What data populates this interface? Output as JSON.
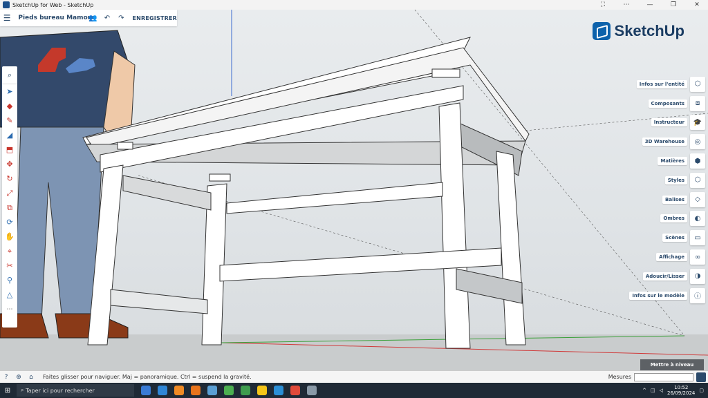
{
  "window": {
    "title": "SketchUp for Web - SketchUp"
  },
  "header": {
    "file_name": "Pieds bureau Mamour",
    "save_label": "ENREGISTRER"
  },
  "logo": {
    "text": "SketchUp"
  },
  "right_panel": [
    {
      "label": "Infos sur l'entité",
      "icon": "info-entity-icon"
    },
    {
      "label": "Composants",
      "icon": "components-icon"
    },
    {
      "label": "Instructeur",
      "icon": "instructor-icon"
    },
    {
      "label": "3D Warehouse",
      "icon": "warehouse-icon"
    },
    {
      "label": "Matières",
      "icon": "materials-icon"
    },
    {
      "label": "Styles",
      "icon": "styles-icon"
    },
    {
      "label": "Balises",
      "icon": "tags-icon"
    },
    {
      "label": "Ombres",
      "icon": "shadows-icon"
    },
    {
      "label": "Scènes",
      "icon": "scenes-icon"
    },
    {
      "label": "Affichage",
      "icon": "display-icon"
    },
    {
      "label": "Adoucir/Lisser",
      "icon": "soften-icon"
    },
    {
      "label": "Infos sur le modèle",
      "icon": "model-info-icon"
    }
  ],
  "level_button": "Mettre à niveau",
  "status": {
    "hint": "Faites glisser pour naviguer. Maj = panoramique. Ctrl = suspend la gravité.",
    "measures_label": "Mesures"
  },
  "taskbar": {
    "search_placeholder": "Taper ici pour rechercher",
    "time": "10:52",
    "date": "26/09/2024"
  },
  "colors": {
    "brand": "#0d62ab",
    "header_text": "#2b4a6b",
    "tool_red": "#c8352c"
  }
}
